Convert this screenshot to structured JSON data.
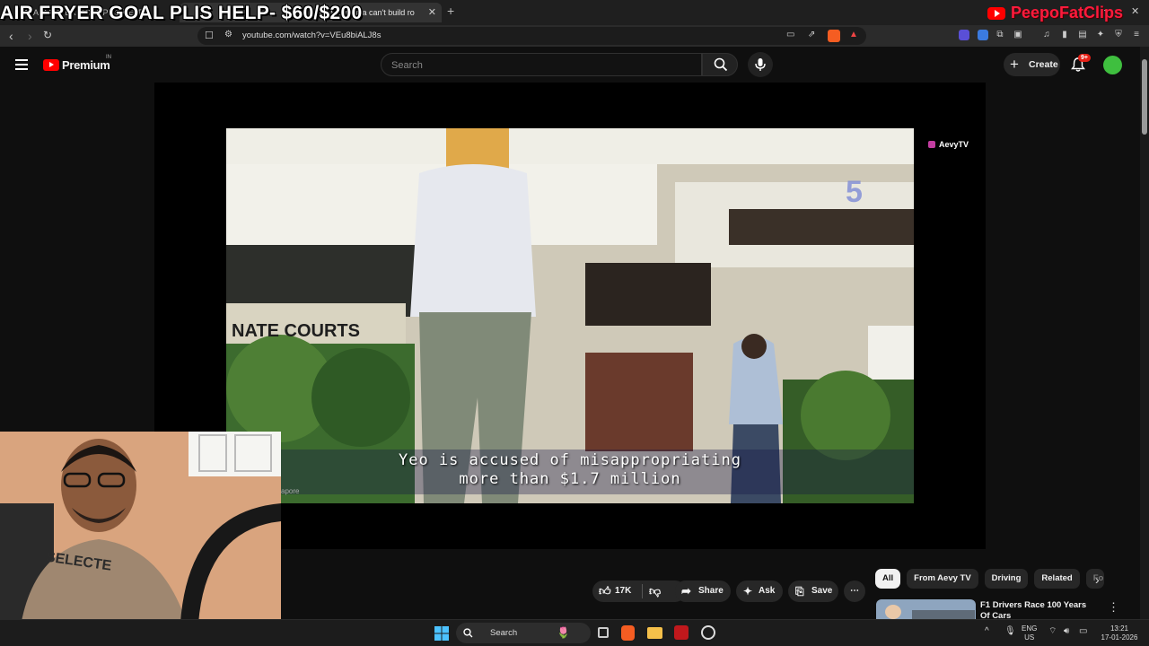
{
  "stream_overlay": {
    "goal_text": "AIR FRYER GOAL PLIS HELP- $60/$200",
    "channel_name": "PeepoFatClips"
  },
  "browser": {
    "tabs": [
      {
        "label": "(1) AIR FRYER GOAL PLIS HELP",
        "active": false
      },
      {
        "label": "(35) Why India can't build ro",
        "active": true
      }
    ],
    "url": "youtube.com/watch?v=VEu8biALJ8s"
  },
  "youtube": {
    "brand": "Premium",
    "region": "IN",
    "search_placeholder": "Search",
    "create_label": "Create",
    "notification_count": "9+"
  },
  "video": {
    "watermark": "AevyTV",
    "subtitle_line1": "Yeo is accused of misappropriating",
    "subtitle_line2": "more than $1.7 million",
    "sign_text": "NATE    COURTS",
    "cam_caption": "apore"
  },
  "actions": {
    "likes": "17K",
    "share": "Share",
    "ask": "Ask",
    "save": "Save"
  },
  "chips": [
    "All",
    "From Aevy TV",
    "Driving",
    "Related",
    "Fo"
  ],
  "recommendation": {
    "title": "F1 Drivers Race 100 Years Of Cars"
  },
  "taskbar": {
    "search_label": "Search",
    "lang": "ENG",
    "region": "US",
    "time": "13:21",
    "date": "17-01-2026"
  },
  "colors": {
    "yt_red": "#ff0000",
    "background": "#0f0f0f",
    "chip_bg": "#272727",
    "overlay_brand": "#ff1a3c"
  }
}
